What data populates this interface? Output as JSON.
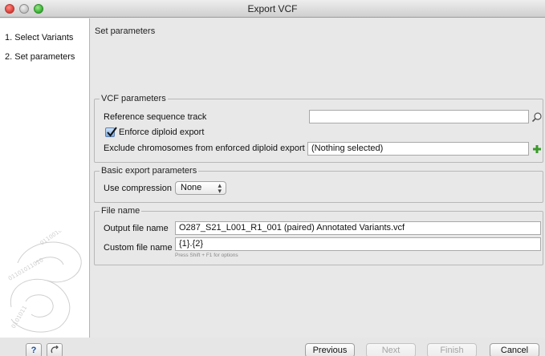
{
  "window": {
    "title": "Export VCF"
  },
  "steps": [
    {
      "label": "1.  Select Variants"
    },
    {
      "label": "2.  Set parameters"
    }
  ],
  "main": {
    "heading": "Set parameters"
  },
  "vcf_parameters": {
    "legend": "VCF parameters",
    "reference_label": "Reference sequence track",
    "reference_value": "",
    "reference_browse_icon": "browse-icon",
    "enforce_diploid_label": "Enforce diploid export",
    "enforce_diploid_checked": true,
    "exclude_label": "Exclude chromosomes from enforced diploid export",
    "exclude_value": "(Nothing selected)",
    "exclude_add_icon": "plus-icon"
  },
  "basic_export": {
    "legend": "Basic export parameters",
    "compression_label": "Use compression",
    "compression_value": "None"
  },
  "file_name": {
    "legend": "File name",
    "output_label": "Output file name",
    "output_value": "O287_S21_L001_R1_001 (paired) Annotated Variants.vcf",
    "custom_label": "Custom file name",
    "custom_value": "{1}.{2}",
    "custom_hint": "Press Shift + F1 for options"
  },
  "footer": {
    "help_label": "?",
    "reset_icon": "reset-icon",
    "previous_label": "Previous",
    "next_label": "Next",
    "finish_label": "Finish",
    "cancel_label": "Cancel"
  },
  "colors": {
    "close": "#e0443e",
    "maximize": "#3fb63a",
    "add_icon": "#3a9a2a",
    "checkbox": "#7aa8dd"
  }
}
